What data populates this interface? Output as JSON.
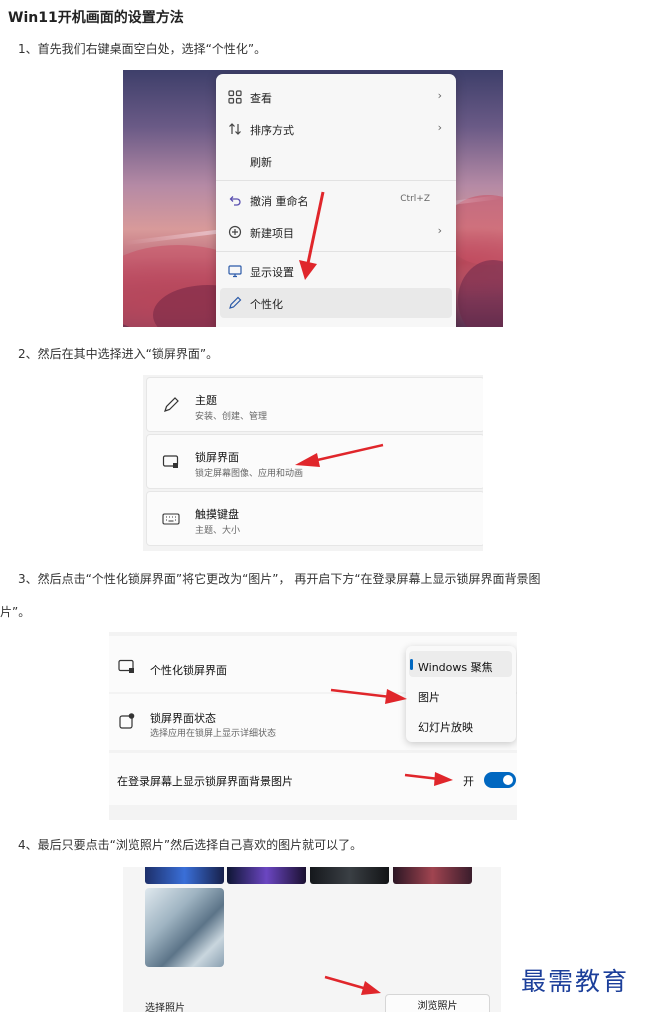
{
  "article": {
    "title": "Win11开机画面的设置方法",
    "step1": "1、首先我们右键桌面空白处，选择“个性化”。",
    "step2": "2、然后在其中选择进入“锁屏界面”。",
    "step3_line1": "3、然后点击“个性化锁屏界面”将它更改为“图片”， 再开启下方“在登录屏幕上显示锁屏界面背景图",
    "step3_line2": "片”。",
    "step4": "4、最后只要点击“浏览照片”然后选择自己喜欢的图片就可以了。"
  },
  "context_menu": {
    "items": [
      {
        "label": "查看",
        "icon": "grid-view-icon",
        "has_submenu": true
      },
      {
        "label": "排序方式",
        "icon": "sort-icon",
        "has_submenu": true
      },
      {
        "label": "刷新",
        "icon": "",
        "has_submenu": false
      },
      {
        "label": "撤消 重命名",
        "icon": "undo-icon",
        "shortcut": "Ctrl+Z"
      },
      {
        "label": "新建项目",
        "icon": "plus-circle-icon",
        "has_submenu": true
      },
      {
        "label": "显示设置",
        "icon": "display-icon",
        "has_submenu": false
      },
      {
        "label": "个性化",
        "icon": "pen-icon",
        "has_submenu": false,
        "highlighted": true
      }
    ]
  },
  "settings_list": {
    "items": [
      {
        "title": "主题",
        "subtitle": "安装、创建、管理",
        "icon": "brush-icon"
      },
      {
        "title": "锁屏界面",
        "subtitle": "锁定屏幕图像、应用和动画",
        "icon": "lock-screen-icon"
      },
      {
        "title": "触摸键盘",
        "subtitle": "主题、大小",
        "icon": "keyboard-icon"
      }
    ]
  },
  "lock_screen": {
    "personalize_label": "个性化锁屏界面",
    "status_title": "锁屏界面状态",
    "status_subtitle": "选择应用在锁屏上显示详细状态",
    "show_background_label": "在登录屏幕上显示锁屏界面背景图片",
    "toggle_text": "开",
    "toggle_on": true,
    "dropdown_options": [
      "Windows 聚焦",
      "图片",
      "幻灯片放映"
    ],
    "dropdown_selected": "Windows 聚焦"
  },
  "photo_picker": {
    "choose_label": "选择照片",
    "browse_button": "浏览照片"
  },
  "watermark": "最需教育",
  "colors": {
    "accent": "#0067c0",
    "arrow": "#e0262b",
    "watermark": "#1c3f9a"
  }
}
